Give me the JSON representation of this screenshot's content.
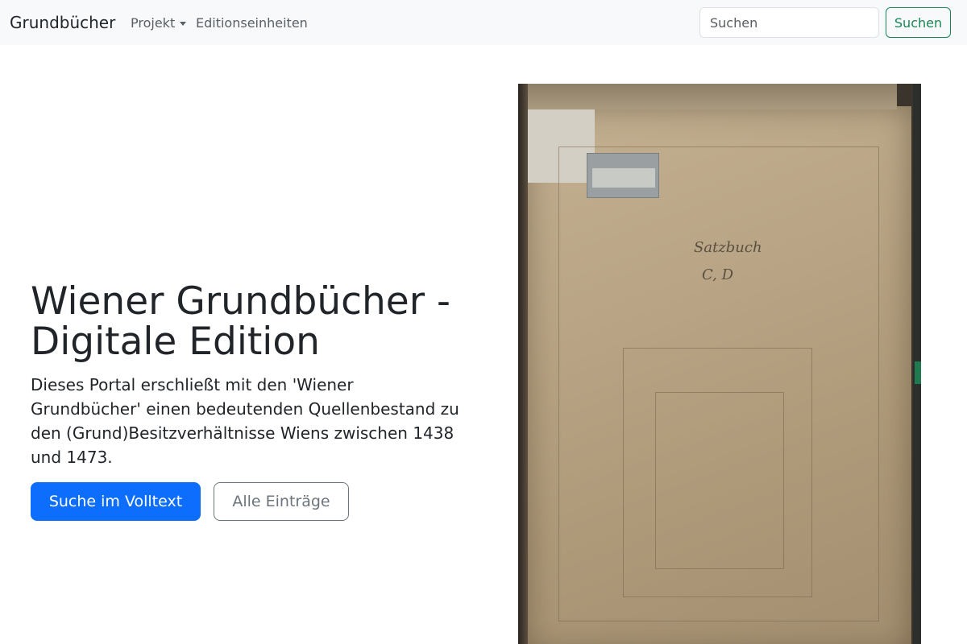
{
  "navbar": {
    "brand": "Grundbücher",
    "items": [
      {
        "label": "Projekt",
        "has_dropdown": true
      },
      {
        "label": "Editionseinheiten",
        "has_dropdown": false
      }
    ],
    "search": {
      "placeholder": "Suchen",
      "button_label": "Suchen"
    }
  },
  "hero": {
    "title": "Wiener Grundbücher - Digitale Edition",
    "lead": "Dieses Portal erschließt mit den 'Wiener Grundbücher' einen bedeutenden Quellenbestand zu den (Grund)Besitzverhältnisse Wiens zwischen 1438 und 1473.",
    "primary_button": "Suche im Volltext",
    "secondary_button": "Alle Einträge"
  },
  "cover_image": {
    "handwriting_line1": "Satzbuch",
    "handwriting_line2": "C, D"
  },
  "colors": {
    "navbar_bg": "#f8f9fa",
    "primary": "#0d6efd",
    "success": "#198754",
    "secondary": "#6c757d"
  }
}
